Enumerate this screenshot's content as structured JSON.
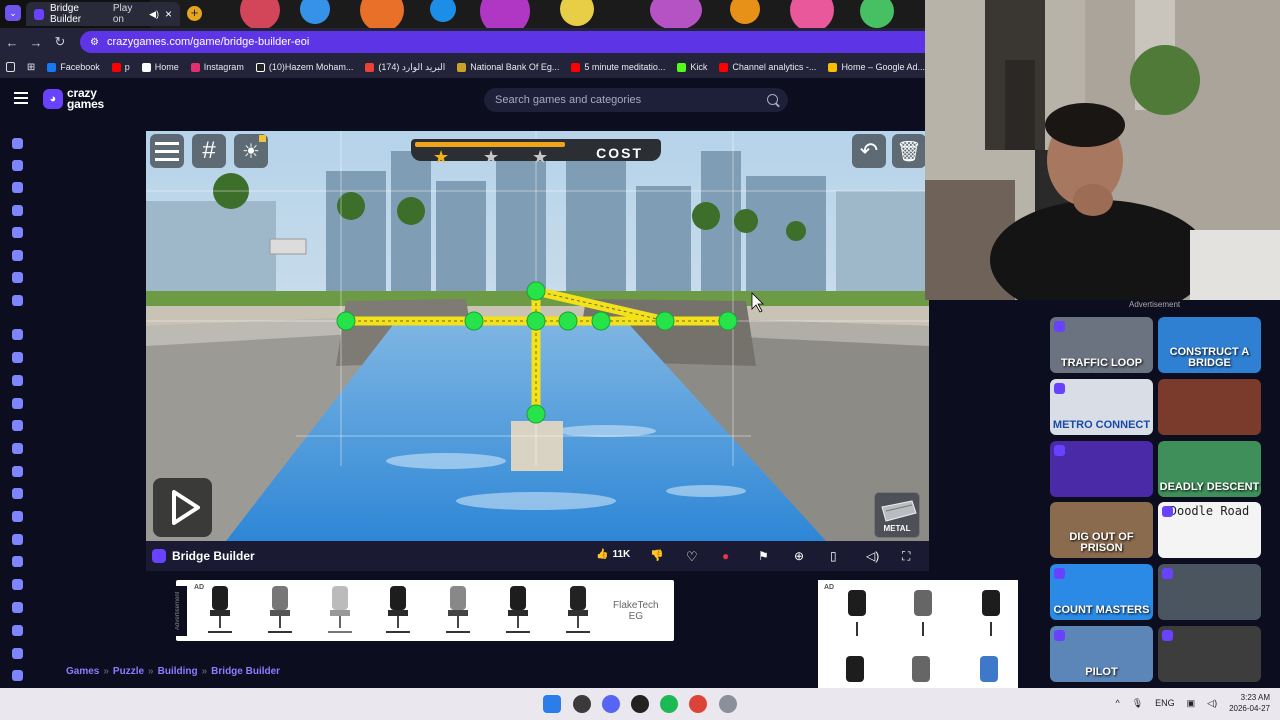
{
  "browser": {
    "active_tab_title": "Bridge Builder",
    "active_tab_suffix": "Play on",
    "url": "crazygames.com/game/bridge-builder-eoi",
    "bookmarks": [
      {
        "label": "Facebook",
        "color": "#1877f2"
      },
      {
        "label": "p",
        "color": "#ff0000"
      },
      {
        "label": "Home",
        "color": "#ffffff"
      },
      {
        "label": "Instagram",
        "color": "#e1306c"
      },
      {
        "label": "(10)Hazem Moham...",
        "color": "#ffffff"
      },
      {
        "label": "(174) البريد الوارد",
        "color": "#ea4335"
      },
      {
        "label": "National Bank Of Eg...",
        "color": "#c9a227"
      },
      {
        "label": "5 minute meditatio...",
        "color": "#ff0000"
      },
      {
        "label": "Kick",
        "color": "#53fc18"
      },
      {
        "label": "Channel analytics -...",
        "color": "#ff0000"
      },
      {
        "label": "Home – Google Ad...",
        "color": "#fbbc04"
      }
    ]
  },
  "site": {
    "logo_line1": "crazy",
    "logo_line2": "games",
    "search_placeholder": "Search games and categories",
    "accent": "#6842ff"
  },
  "game": {
    "title": "Bridge Builder",
    "cost_label": "COST",
    "cost_progress": 0.62,
    "stars_earned": 1,
    "stars_total": 3,
    "material_label": "METAL",
    "likes": "11K"
  },
  "ads": {
    "tag": "AD",
    "vertical_label": "Advertisement",
    "brand_line1": "FlakeTech",
    "brand_line2": "EG",
    "right_label": "Advertisement"
  },
  "breadcrumb": [
    "Games",
    "Puzzle",
    "Building",
    "Bridge Builder"
  ],
  "recommended": [
    {
      "label": "TRAFFIC LOOP",
      "bg": "#6b7280"
    },
    {
      "label": "CONSTRUCT A BRIDGE",
      "bg": "#2f7fd3"
    },
    {
      "label": "METRO CONNECT",
      "bg": "#d8dde6"
    },
    {
      "label": "",
      "bg": "#7a3b2c"
    },
    {
      "label": "",
      "bg": "#4b2aa8"
    },
    {
      "label": "DEADLY DESCENT",
      "bg": "#3f8f5a"
    },
    {
      "label": "DIG OUT OF PRISON",
      "bg": "#8a6b4e"
    },
    {
      "label": "Doodle Road",
      "bg": "#f4f4f4"
    },
    {
      "label": "COUNT MASTERS",
      "bg": "#2a8ae6"
    },
    {
      "label": "",
      "bg": "#4a5560"
    },
    {
      "label": "PILOT",
      "bg": "#5c86b8"
    },
    {
      "label": "",
      "bg": "#3d3d3d"
    }
  ],
  "taskbar": {
    "language": "ENG",
    "time": "3:23 AM",
    "date": "2026-04-27"
  }
}
